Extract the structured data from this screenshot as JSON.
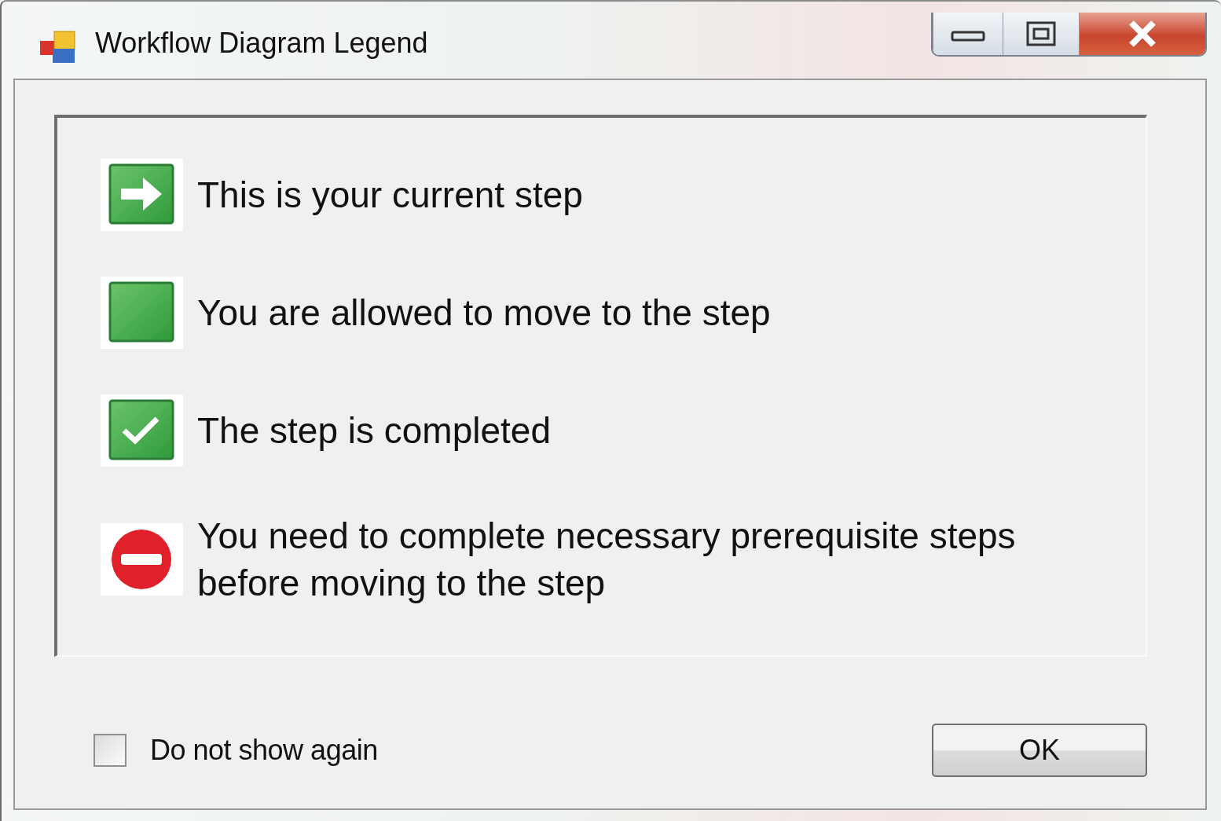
{
  "window": {
    "title": "Workflow Diagram Legend"
  },
  "legend": [
    {
      "kind": "current",
      "text": "This is your current step"
    },
    {
      "kind": "allowed",
      "text": "You are allowed to move to the step"
    },
    {
      "kind": "completed",
      "text": "The step is completed"
    },
    {
      "kind": "blocked",
      "text": "You need to complete necessary prerequisite steps before moving to the step"
    }
  ],
  "do_not_show_again": {
    "label": "Do not show again",
    "checked": false
  },
  "buttons": [
    {
      "label": "OK"
    }
  ]
}
